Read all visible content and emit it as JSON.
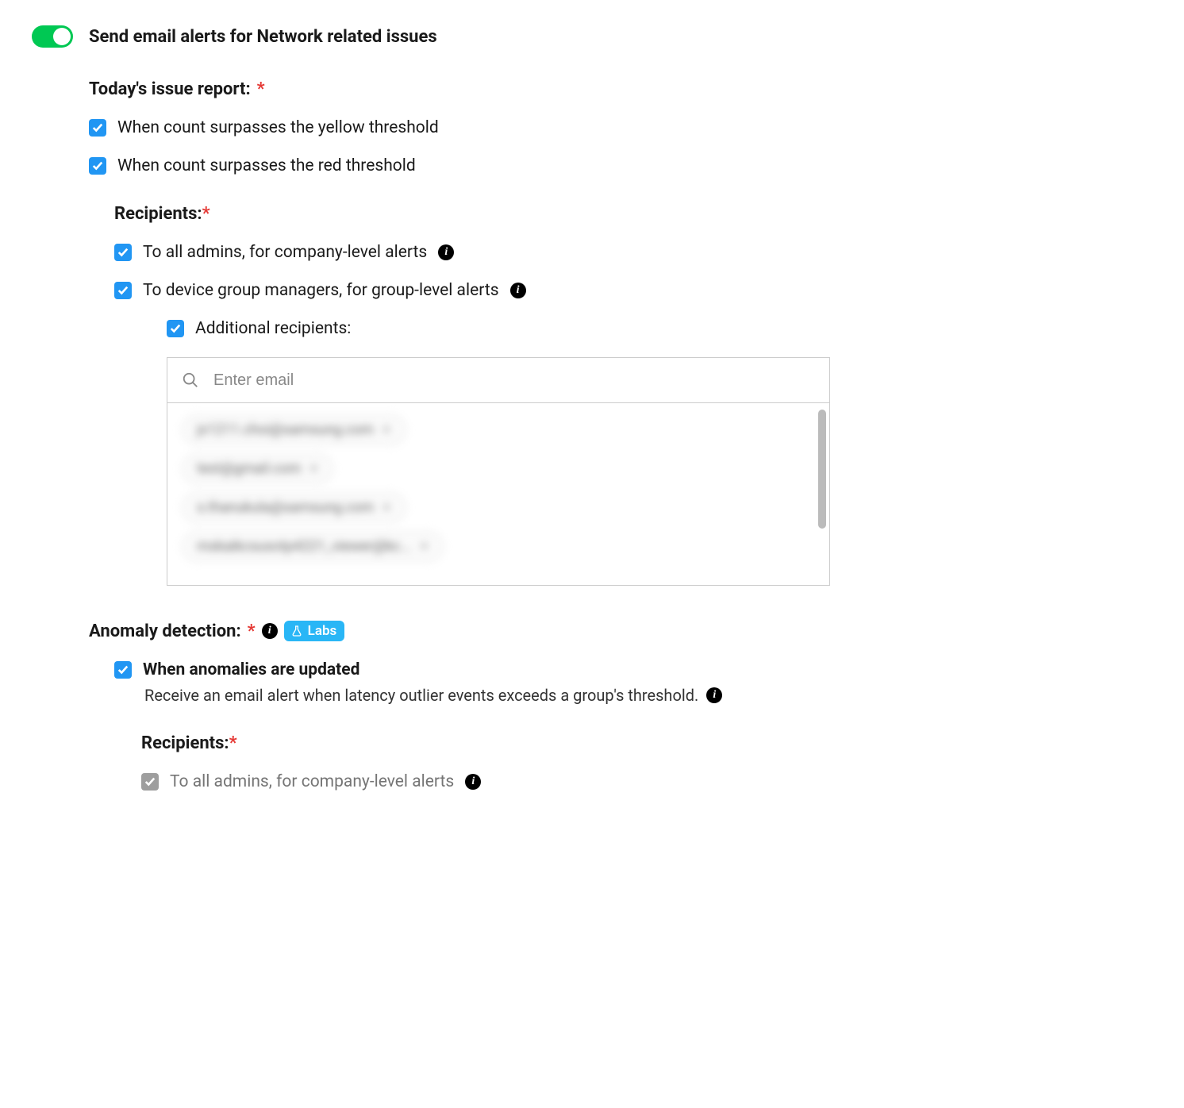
{
  "header": {
    "toggle_on": true,
    "title": "Send email alerts for Network related issues"
  },
  "today_report": {
    "title": "Today's issue report:",
    "required": "*",
    "yellow_label": "When count surpasses the yellow threshold",
    "red_label": "When count surpasses the red threshold"
  },
  "recipients": {
    "title": "Recipients:",
    "required": "*",
    "admins_label": "To all admins, for company-level alerts",
    "managers_label": "To device group managers, for group-level alerts",
    "additional_label": "Additional recipients:",
    "email_placeholder": "Enter email",
    "chips": [
      "jx1211.choi@samsung.com",
      "test@gmail.com",
      "s.thanukula@samsung.com",
      "mskaikcsusotp4221_viewer@kc..."
    ]
  },
  "anomaly": {
    "title": "Anomaly detection:",
    "required": "*",
    "labs_label": "Labs",
    "updated_label": "When anomalies are updated",
    "description": "Receive an email alert when latency outlier events exceeds a group's threshold.",
    "recipients_title": "Recipients:",
    "recipients_required": "*",
    "admins_label": "To all admins, for company-level alerts"
  }
}
